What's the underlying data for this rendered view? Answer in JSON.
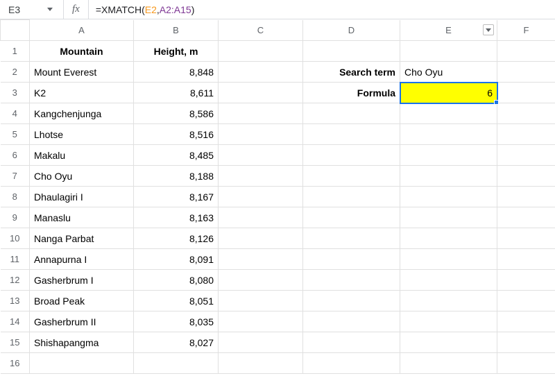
{
  "formula_bar": {
    "name_box": "E3",
    "fx_label": "fx",
    "tokens": {
      "eq": "=",
      "fn": "XMATCH",
      "open": "(",
      "ref1": "E2",
      "comma": ",",
      "ref2": "A2:A15",
      "close": ")"
    }
  },
  "columns": [
    "A",
    "B",
    "C",
    "D",
    "E",
    "F"
  ],
  "active": {
    "col": "E",
    "row": 3
  },
  "headers": {
    "A1": "Mountain",
    "B1": "Height, m",
    "D2": "Search term",
    "D3": "Formula"
  },
  "data": {
    "mountains": [
      {
        "name": "Mount Everest",
        "height": "8,848"
      },
      {
        "name": "K2",
        "height": "8,611"
      },
      {
        "name": "Kangchenjunga",
        "height": "8,586"
      },
      {
        "name": "Lhotse",
        "height": "8,516"
      },
      {
        "name": "Makalu",
        "height": "8,485"
      },
      {
        "name": "Cho Oyu",
        "height": "8,188"
      },
      {
        "name": "Dhaulagiri I",
        "height": "8,167"
      },
      {
        "name": "Manaslu",
        "height": "8,163"
      },
      {
        "name": "Nanga Parbat",
        "height": "8,126"
      },
      {
        "name": "Annapurna I",
        "height": "8,091"
      },
      {
        "name": "Gasherbrum I",
        "height": "8,080"
      },
      {
        "name": "Broad Peak",
        "height": "8,051"
      },
      {
        "name": "Gasherbrum II",
        "height": "8,035"
      },
      {
        "name": "Shishapangma",
        "height": "8,027"
      }
    ],
    "search_term": "Cho Oyu",
    "formula_result": "6"
  },
  "row_count": 16
}
